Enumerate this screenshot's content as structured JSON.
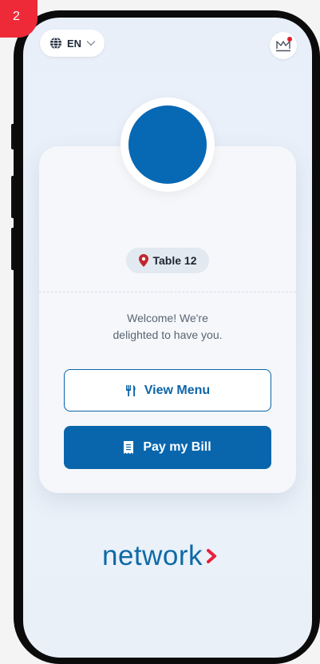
{
  "step_badge": "2",
  "language": {
    "code": "EN",
    "icon": "globe-icon",
    "chevron": "chevron-down-icon"
  },
  "crown": {
    "icon": "crown-icon",
    "notification": true
  },
  "restaurant_logo": {
    "color": "#0768b4"
  },
  "table": {
    "icon": "location-pin-icon",
    "label": "Table 12"
  },
  "welcome": {
    "line1": "Welcome! We're",
    "line2": "delighted to have you."
  },
  "actions": {
    "view_menu": {
      "label": "View Menu",
      "icon": "cutlery-icon"
    },
    "pay_bill": {
      "label": "Pay my Bill",
      "icon": "receipt-icon"
    }
  },
  "brand": {
    "name": "network",
    "accent": "#e8213b"
  },
  "colors": {
    "primary": "#0966ad",
    "accent": "#e8213b"
  }
}
